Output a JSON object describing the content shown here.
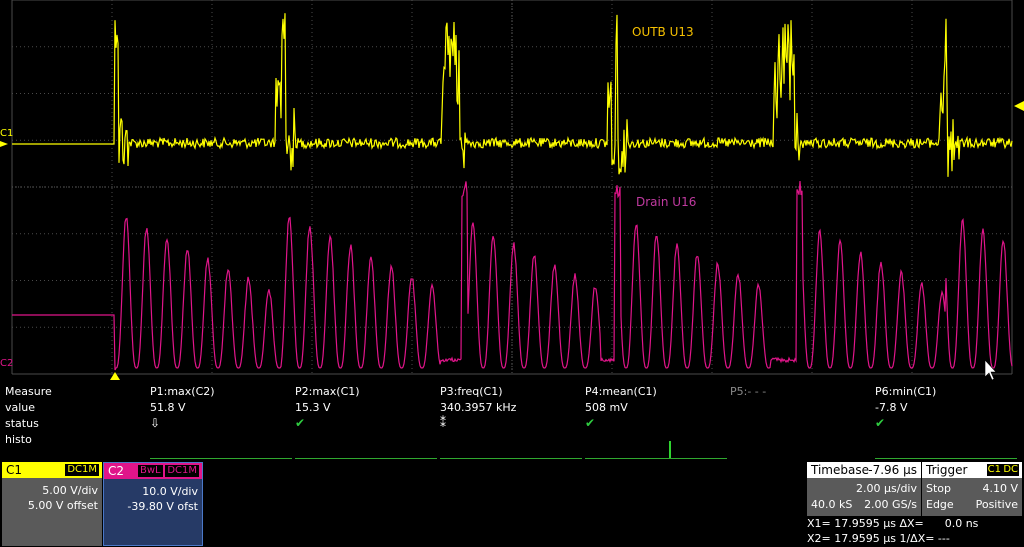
{
  "waveform": {
    "trace1_label": "OUTB U13",
    "trace2_label": "Drain U16",
    "marker_c1": "C1",
    "marker_c2": "C2",
    "trace1_color": "#ffff00",
    "trace2_color": "#e0158a"
  },
  "measure": {
    "row_labels": [
      "Measure",
      "value",
      "status",
      "histo"
    ],
    "params": [
      {
        "name": "P1:max(C2)",
        "value": "51.8 V",
        "status": "arrow-down-icon",
        "status_glyph": "⇩",
        "status_color": "#ffffff"
      },
      {
        "name": "P2:max(C1)",
        "value": "15.3 V",
        "status": "check-icon",
        "status_glyph": "✔",
        "status_color": "#2ecc40"
      },
      {
        "name": "P3:freq(C1)",
        "value": "340.3957 kHz",
        "status": "asterisk-icon",
        "status_glyph": "⁑",
        "status_color": "#ffffff"
      },
      {
        "name": "P4:mean(C1)",
        "value": "508 mV",
        "status": "check-icon",
        "status_glyph": "✔",
        "status_color": "#2ecc40"
      },
      {
        "name": "P5:- - -",
        "value": "",
        "status": "",
        "status_glyph": "",
        "status_color": "#ffffff"
      },
      {
        "name": "P6:min(C1)",
        "value": "-7.8 V",
        "status": "check-icon",
        "status_glyph": "✔",
        "status_color": "#2ecc40"
      }
    ]
  },
  "channels": {
    "c1": {
      "name": "C1",
      "coupling": "DC1M",
      "vdiv": "5.00 V/div",
      "offset": "5.00 V offset",
      "color": "#ffff00"
    },
    "c2": {
      "name": "C2",
      "bwl": "BwL",
      "coupling": "DC1M",
      "vdiv": "10.0 V/div",
      "offset": "-39.80 V ofst",
      "color": "#e0158a"
    }
  },
  "timebase": {
    "title": "Timebase",
    "delay": "-7.96 µs",
    "tdiv": "2.00 µs/div",
    "samples": "40.0 kS",
    "rate": "2.00 GS/s"
  },
  "trigger": {
    "title": "Trigger",
    "channel": "C1",
    "coupling": "DC",
    "mode": "Stop",
    "level": "4.10 V",
    "type": "Edge",
    "slope": "Positive"
  },
  "cursors": {
    "x1": "X1= 17.9595 µs ΔX=      0.0 ns",
    "x2": "X2= 17.9595 µs 1/ΔX= ---"
  }
}
